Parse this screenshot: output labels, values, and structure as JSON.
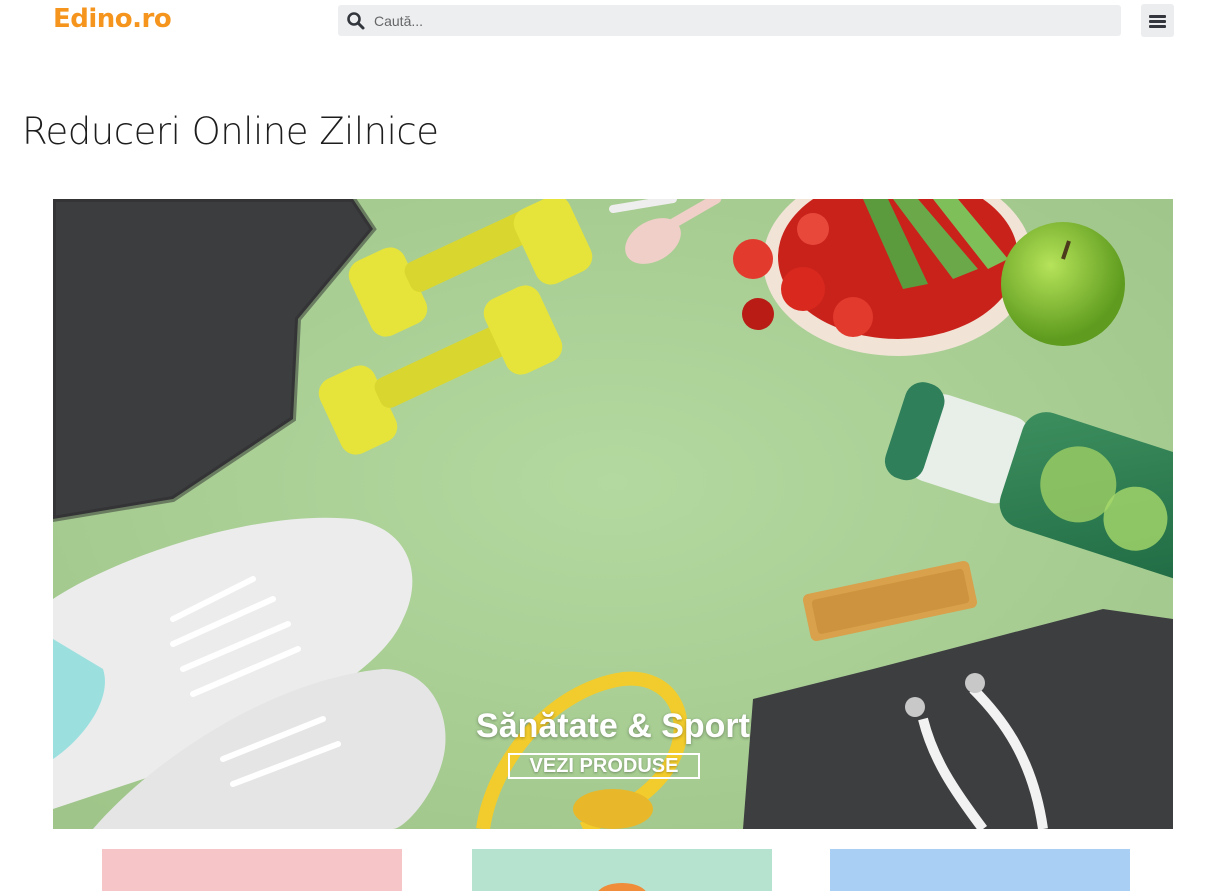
{
  "header": {
    "logo": "Edino.ro",
    "search": {
      "placeholder": "Caută..."
    },
    "menu_icon": "hamburger-menu-icon"
  },
  "main": {
    "page_title": "Reduceri Online Zilnice",
    "hero": {
      "title": "Sănătate & Sport",
      "button_label": "VEZI PRODUSE"
    },
    "categories": [
      {
        "color": "#f6c5c8"
      },
      {
        "color": "#b5e3cf"
      },
      {
        "color": "#a9cff5"
      }
    ]
  },
  "colors": {
    "brand": "#f5951d",
    "search_bg": "#eceef0",
    "hero_bg": "#a9cf95"
  }
}
